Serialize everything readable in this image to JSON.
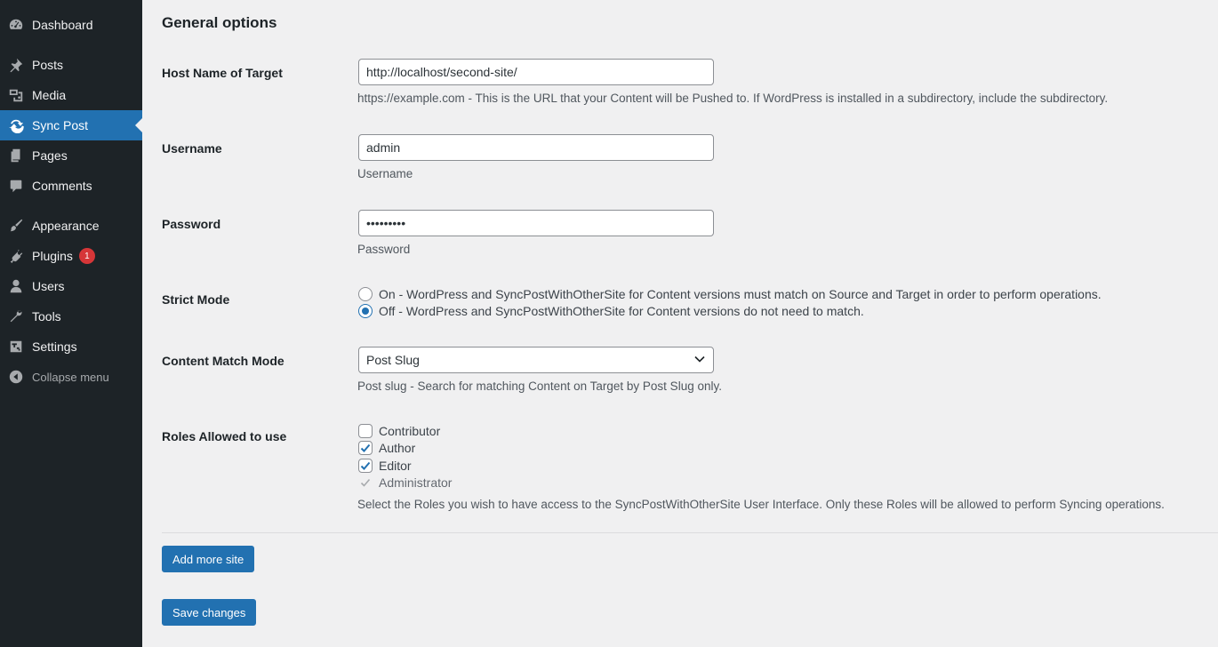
{
  "sidebar": {
    "items": [
      {
        "label": "Dashboard",
        "icon": "dashboard-icon"
      },
      {
        "label": "Posts",
        "icon": "pin-icon"
      },
      {
        "label": "Media",
        "icon": "media-icon"
      },
      {
        "label": "Sync Post",
        "icon": "sync-icon",
        "active": true
      },
      {
        "label": "Pages",
        "icon": "pages-icon"
      },
      {
        "label": "Comments",
        "icon": "comment-icon"
      },
      {
        "label": "Appearance",
        "icon": "brush-icon"
      },
      {
        "label": "Plugins",
        "icon": "plugin-icon",
        "badge": "1"
      },
      {
        "label": "Users",
        "icon": "user-icon"
      },
      {
        "label": "Tools",
        "icon": "wrench-icon"
      },
      {
        "label": "Settings",
        "icon": "settings-icon"
      }
    ],
    "collapse_label": "Collapse menu"
  },
  "main": {
    "section_title": "General options",
    "host": {
      "label": "Host Name of Target",
      "value": "http://localhost/second-site/",
      "description": "https://example.com - This is the URL that your Content will be Pushed to. If WordPress is installed in a subdirectory, include the subdirectory."
    },
    "username": {
      "label": "Username",
      "value": "admin",
      "description": "Username"
    },
    "password": {
      "label": "Password",
      "value": "•••••••••",
      "description": "Password"
    },
    "strict_mode": {
      "label": "Strict Mode",
      "on_label": "On - WordPress and SyncPostWithOtherSite for Content versions must match on Source and Target in order to perform operations.",
      "off_label": "Off - WordPress and SyncPostWithOtherSite for Content versions do not need to match.",
      "selected": "off"
    },
    "content_match": {
      "label": "Content Match Mode",
      "selected": "Post Slug",
      "description": "Post slug - Search for matching Content on Target by Post Slug only."
    },
    "roles": {
      "label": "Roles Allowed to use",
      "options": [
        {
          "label": "Contributor",
          "checked": false
        },
        {
          "label": "Author",
          "checked": true
        },
        {
          "label": "Editor",
          "checked": true
        },
        {
          "label": "Administrator",
          "checked": true,
          "disabled": true
        }
      ],
      "description": "Select the Roles you wish to have access to the SyncPostWithOtherSite User Interface. Only these Roles will be allowed to perform Syncing operations."
    },
    "add_site_label": "Add more site",
    "save_label": "Save changes"
  },
  "colors": {
    "sidebar_bg": "#1d2327",
    "accent": "#2271b1",
    "badge": "#d63638",
    "page_bg": "#f0f0f1"
  }
}
